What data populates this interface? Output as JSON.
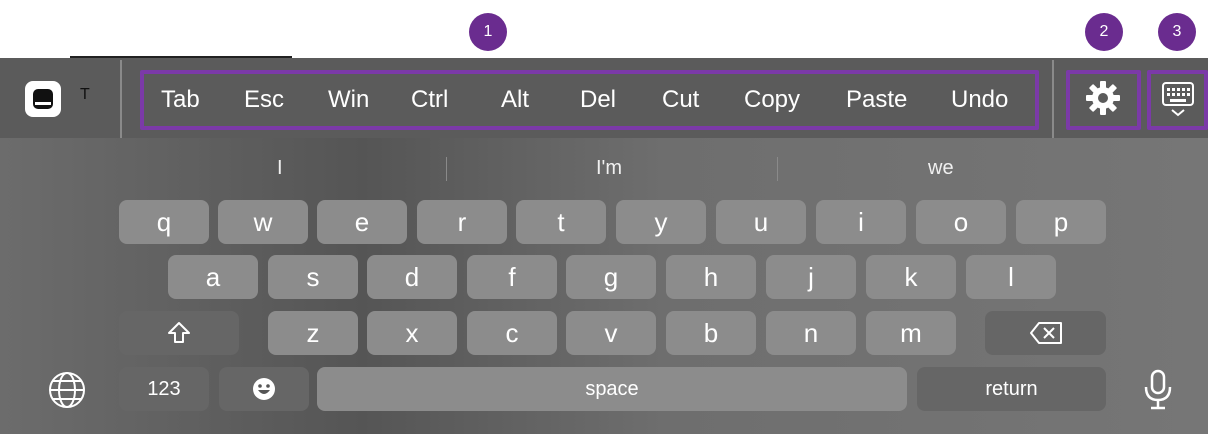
{
  "badges": [
    "1",
    "2",
    "3"
  ],
  "toolbar": {
    "app_label": "T",
    "buttons": [
      "Tab",
      "Esc",
      "Win",
      "Ctrl",
      "Alt",
      "Del",
      "Cut",
      "Copy",
      "Paste",
      "Undo"
    ]
  },
  "suggestions": [
    "I",
    "I'm",
    "we"
  ],
  "keyboard": {
    "row1": [
      "q",
      "w",
      "e",
      "r",
      "t",
      "y",
      "u",
      "i",
      "o",
      "p"
    ],
    "row2": [
      "a",
      "s",
      "d",
      "f",
      "g",
      "h",
      "j",
      "k",
      "l"
    ],
    "row3": [
      "z",
      "x",
      "c",
      "v",
      "b",
      "n",
      "m"
    ],
    "numbers_key": "123",
    "space_key": "space",
    "return_key": "return"
  },
  "colors": {
    "highlight": "#7b3aa8",
    "badge": "#6a2c8f",
    "toolbar_bg": "#5b5b5b"
  },
  "icons": [
    "app-icon",
    "gear-icon",
    "keyboard-hide-icon",
    "shift-icon",
    "backspace-icon",
    "globe-icon",
    "emoji-icon",
    "microphone-icon"
  ]
}
